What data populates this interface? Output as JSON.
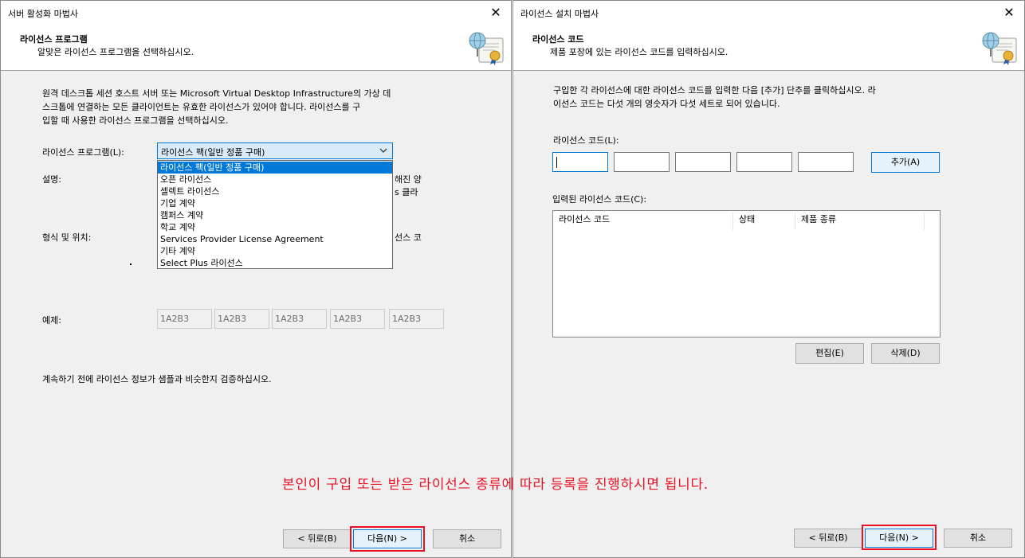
{
  "left_wizard": {
    "window_title": "서버 활성화 마법사",
    "header_title": "라이선스 프로그램",
    "header_subtitle": "알맞은 라이선스 프로그램을 선택하십시오.",
    "intro_lines": [
      "원격 데스크톱 세션 호스트 서버 또는 Microsoft Virtual Desktop Infrastructure의 가상 데",
      "스크톱에 연결하는 모든 클라이언트는 유효한 라이선스가 있어야 합니다. 라이선스를 구",
      "입할 때 사용한 라이선스 프로그램을 선택하십시오."
    ],
    "program_label": "라이선스 프로그램(L):",
    "program_selected": "라이선스 팩(일반 정품 구매)",
    "program_options": [
      "라이선스 팩(일반 정품 구매)",
      "오픈 라이선스",
      "셀렉트 라이선스",
      "기업 계약",
      "캠퍼스 계약",
      "학교 계약",
      "Services Provider License Agreement",
      "기타 계약",
      "Select Plus 라이선스"
    ],
    "description_label": "설명:",
    "description_cut_1": "해진 양",
    "description_cut_2": "s 클라",
    "format_label": "형식 및 위치:",
    "format_cut": "선스 코",
    "example_label": "예제:",
    "example_codes": [
      "1A2B3",
      "1A2B3",
      "1A2B3",
      "1A2B3",
      "1A2B3"
    ],
    "verify_text": "계속하기 전에 라이선스 정보가 샘플과 비슷한지 검증하십시오.",
    "back_label": "< 뒤로(B)",
    "next_label": "다음(N) >",
    "cancel_label": "취소"
  },
  "right_wizard": {
    "window_title": "라이선스 설치 마법사",
    "header_title": "라이선스 코드",
    "header_subtitle": "제품 포장에 있는 라이선스 코드를 입력하십시오.",
    "intro_lines": [
      "구입한 각 라이선스에 대한 라이선스 코드를 입력한 다음 [추가] 단추를 클릭하십시오. 라",
      "이선스 코드는 다섯 개의 영숫자가 다섯 세트로 되어 있습니다."
    ],
    "code_label": "라이선스 코드(L):",
    "add_label": "추가(A)",
    "entered_label": "입력된 라이선스 코드(C):",
    "columns": [
      "라이선스 코드",
      "상태",
      "제품 종류"
    ],
    "edit_label": "편집(E)",
    "delete_label": "삭제(D)",
    "back_label": "< 뒤로(B)",
    "next_label": "다음(N) >",
    "cancel_label": "취소"
  },
  "annotation": {
    "text": "본인이 구입 또는 받은 라이선스 종류에 따라 등록을 진행하시면 됩니다.",
    "color": "#e81123"
  },
  "colors": {
    "accent": "#0078d7",
    "highlight_box": "#e81123",
    "dialog_bg": "#f0f0f0"
  }
}
